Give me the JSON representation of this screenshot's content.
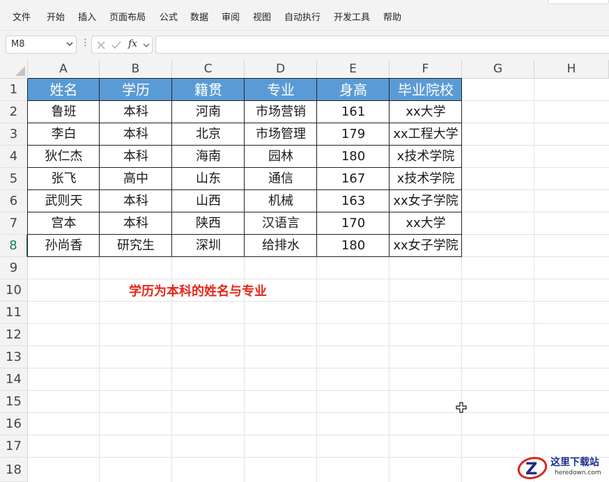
{
  "menu": [
    "文件",
    "开始",
    "插入",
    "页面布局",
    "公式",
    "数据",
    "审阅",
    "视图",
    "自动执行",
    "开发工具",
    "帮助"
  ],
  "formula_bar": {
    "name_box": "M8",
    "fx_label": "fx",
    "formula": ""
  },
  "columns": [
    "A",
    "B",
    "C",
    "D",
    "E",
    "F",
    "G",
    "H"
  ],
  "rows": [
    "1",
    "2",
    "3",
    "4",
    "5",
    "6",
    "7",
    "8",
    "9",
    "10",
    "11",
    "12",
    "13",
    "14",
    "15",
    "16",
    "17",
    "18"
  ],
  "active_row": "8",
  "table": {
    "headers": [
      "姓名",
      "学历",
      "籍贯",
      "专业",
      "身高",
      "毕业院校"
    ],
    "rows": [
      [
        "鲁班",
        "本科",
        "河南",
        "市场营销",
        "161",
        "xx大学"
      ],
      [
        "李白",
        "本科",
        "北京",
        "市场管理",
        "179",
        "xx工程大学"
      ],
      [
        "狄仁杰",
        "本科",
        "海南",
        "园林",
        "180",
        "x技术学院"
      ],
      [
        "张飞",
        "高中",
        "山东",
        "通信",
        "167",
        "x技术学院"
      ],
      [
        "武则天",
        "本科",
        "山西",
        "机械",
        "163",
        "xx女子学院"
      ],
      [
        "宫本",
        "本科",
        "陕西",
        "汉语言",
        "170",
        "xx大学"
      ],
      [
        "孙尚香",
        "研究生",
        "深圳",
        "给排水",
        "180",
        "xx女子学院"
      ]
    ]
  },
  "note": "学历为本科的姓名与专业",
  "colors": {
    "header_fill": "#5b9bd5",
    "note_text": "#e8261b",
    "active_row_accent": "#1f7a4c"
  },
  "watermark": {
    "title": "这里下载站",
    "url": "heredown.com"
  }
}
